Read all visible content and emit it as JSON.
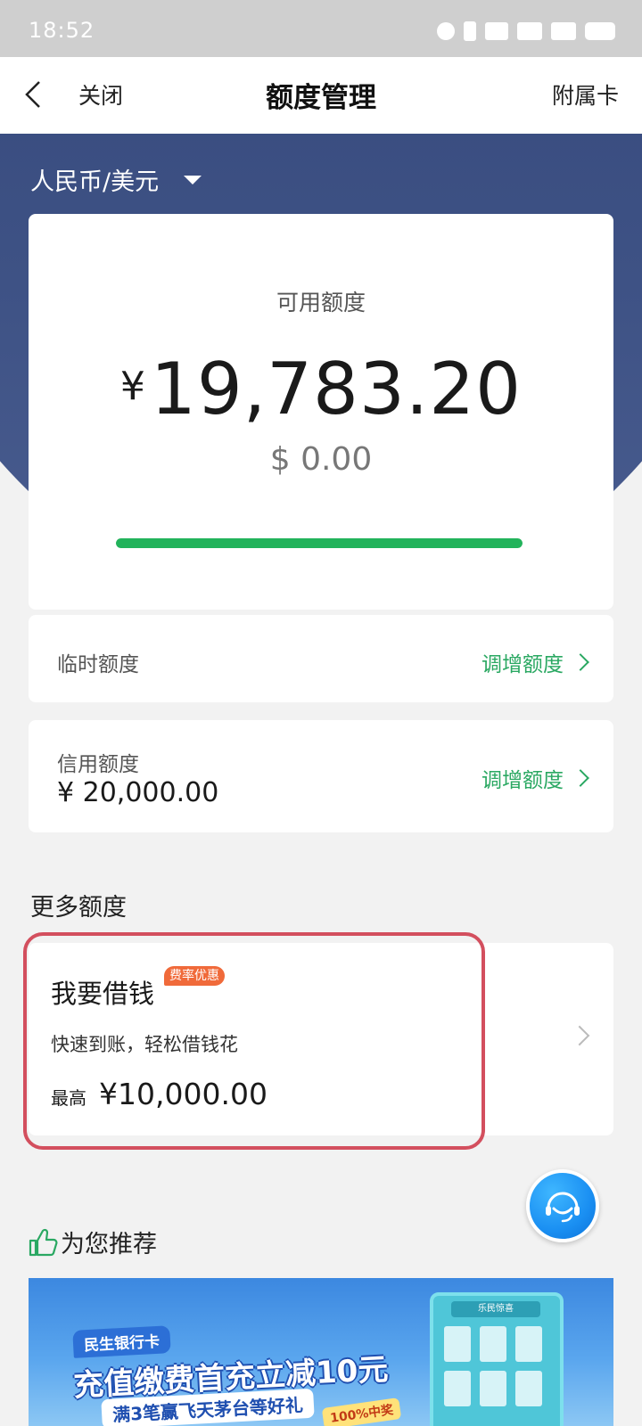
{
  "status_bar": {
    "time": "18:52",
    "icons": [
      "alarm-icon",
      "vibrate-icon",
      "hd-icon",
      "signal-5g-icon",
      "signal-5g-icon",
      "battery-icon"
    ]
  },
  "nav": {
    "close_label": "关闭",
    "title": "额度管理",
    "right_label": "附属卡"
  },
  "currency_selector": {
    "label": "人民币/美元"
  },
  "available_credit": {
    "label": "可用额度",
    "currency_symbol": "¥",
    "amount": "19,783.20",
    "usd_amount": "$ 0.00",
    "usage_fraction": 1.0,
    "bar_color": "#22b35b"
  },
  "temporary_limit": {
    "label": "临时额度",
    "action_label": "调增额度"
  },
  "credit_limit": {
    "label": "信用额度",
    "value": "¥ 20,000.00",
    "action_label": "调增额度"
  },
  "more_limits": {
    "section_title": "更多额度",
    "loan": {
      "title": "我要借钱",
      "tag": "费率优惠",
      "subtitle": "快速到账，轻松借钱花",
      "max_label": "最高",
      "max_value": "¥10,000.00"
    }
  },
  "recommend": {
    "title": "为您推荐"
  },
  "banner": {
    "bank_tag": "民生银行卡",
    "headline": "充值缴费首充立减10元",
    "subline": "满3笔赢飞天茅台等好礼",
    "prize_tag": "100%中奖",
    "box_title": "乐民惊喜"
  },
  "colors": {
    "header_bg": "#2c3d70",
    "accent_green": "#2aa862",
    "highlight_red": "#d34f5e",
    "tag_orange": "#f06a3a"
  }
}
